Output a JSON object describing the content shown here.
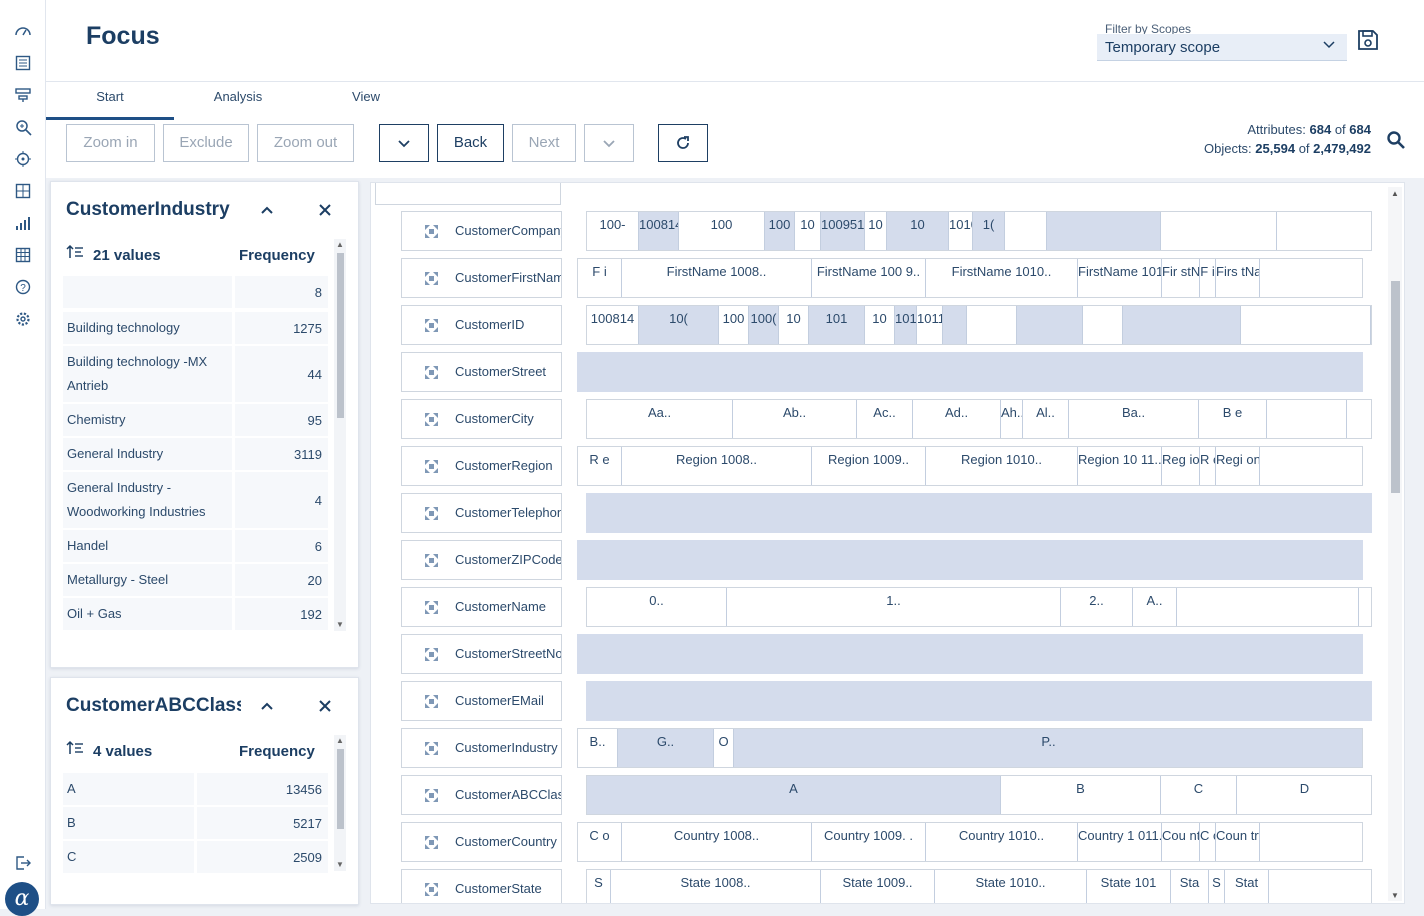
{
  "app": {
    "title": "Focus",
    "scope_label": "Filter by Scopes",
    "scope_value": "Temporary scope"
  },
  "rail_icons": [
    "dashboard-icon",
    "report-icon",
    "filter-icon",
    "zoom-icon",
    "target-icon",
    "grid-icon",
    "bar-chart-icon",
    "table-icon",
    "help-icon",
    "settings-icon",
    "logout-icon"
  ],
  "tabs": [
    "Start",
    "Analysis",
    "View"
  ],
  "toolbar": {
    "zoom_in": "Zoom in",
    "exclude": "Exclude",
    "zoom_out": "Zoom out",
    "back": "Back",
    "next": "Next"
  },
  "stats": {
    "attributes_label": "Attributes:",
    "attributes_value": "684",
    "attributes_total": "684",
    "objects_label": "Objects:",
    "objects_value": "25,594",
    "objects_total": "2,479,492",
    "of": "of"
  },
  "cards": [
    {
      "title": "CustomerIndustry",
      "count_label": "21 values",
      "freq_label": "Frequency",
      "rows": [
        {
          "label": "",
          "value": "8"
        },
        {
          "label": "Building technology",
          "value": "1275"
        },
        {
          "label": "Building technology -MX Antrieb",
          "value": "44"
        },
        {
          "label": "Chemistry",
          "value": "95"
        },
        {
          "label": "General Industry",
          "value": "3119"
        },
        {
          "label": "General Industry - Woodworking Industries",
          "value": "4"
        },
        {
          "label": "Handel",
          "value": "6"
        },
        {
          "label": "Metallurgy - Steel",
          "value": "20"
        },
        {
          "label": "Oil + Gas",
          "value": "192"
        }
      ]
    },
    {
      "title": "CustomerABCClass",
      "count_label": "4 values",
      "freq_label": "Frequency",
      "rows": [
        {
          "label": "A",
          "value": "13456"
        },
        {
          "label": "B",
          "value": "5217"
        },
        {
          "label": "C",
          "value": "2509"
        }
      ]
    }
  ],
  "attributes": [
    {
      "name": "CustomerCompany",
      "segments": [
        "100-",
        "100814",
        "100",
        "100",
        "10",
        "100951",
        "10",
        "10",
        "101070",
        "1("
      ]
    },
    {
      "name": "CustomerFirstName",
      "segments": [
        "F i",
        "FirstName 1008..",
        "FirstName 100 9..",
        "FirstName 1010..",
        "FirstName 1011..",
        "Fir stN",
        "F i",
        "Firs tNam"
      ]
    },
    {
      "name": "CustomerID",
      "segments": [
        "100814",
        "10(",
        "100",
        "100(",
        "10",
        "101",
        "10",
        "101070",
        "1011("
      ]
    },
    {
      "name": "CustomerStreet",
      "segments": []
    },
    {
      "name": "CustomerCity",
      "segments": [
        "Aa..",
        "Ab..",
        "Ac..",
        "Ad..",
        "Ah..",
        "Al..",
        "Ba..",
        "B e"
      ]
    },
    {
      "name": "CustomerRegion",
      "segments": [
        "R e",
        "Region 1008..",
        "Region 1009..",
        "Region 1010..",
        "Region 10 11..",
        "Reg ion",
        "R e",
        "Regi on 1"
      ]
    },
    {
      "name": "CustomerTelephone",
      "segments": []
    },
    {
      "name": "CustomerZIPCode",
      "segments": []
    },
    {
      "name": "CustomerName",
      "segments": [
        "0..",
        "1..",
        "2..",
        "A.."
      ]
    },
    {
      "name": "CustomerStreetNo",
      "segments": []
    },
    {
      "name": "CustomerEMail",
      "segments": []
    },
    {
      "name": "CustomerIndustry",
      "segments": [
        "B..",
        "G..",
        "O",
        "P.."
      ]
    },
    {
      "name": "CustomerABCClass",
      "segments": [
        "A",
        "B",
        "C",
        "D"
      ]
    },
    {
      "name": "CustomerCountry",
      "segments": [
        "C o",
        "Country 1008..",
        "Country 1009. .",
        "Country 1010..",
        "Country 1 011..",
        "Cou ntr",
        "C o",
        "Coun try"
      ]
    },
    {
      "name": "CustomerState",
      "segments": [
        "S",
        "State 1008..",
        "State 1009..",
        "State 1010..",
        "State 101",
        "Sta",
        "S",
        "Stat"
      ]
    }
  ]
}
